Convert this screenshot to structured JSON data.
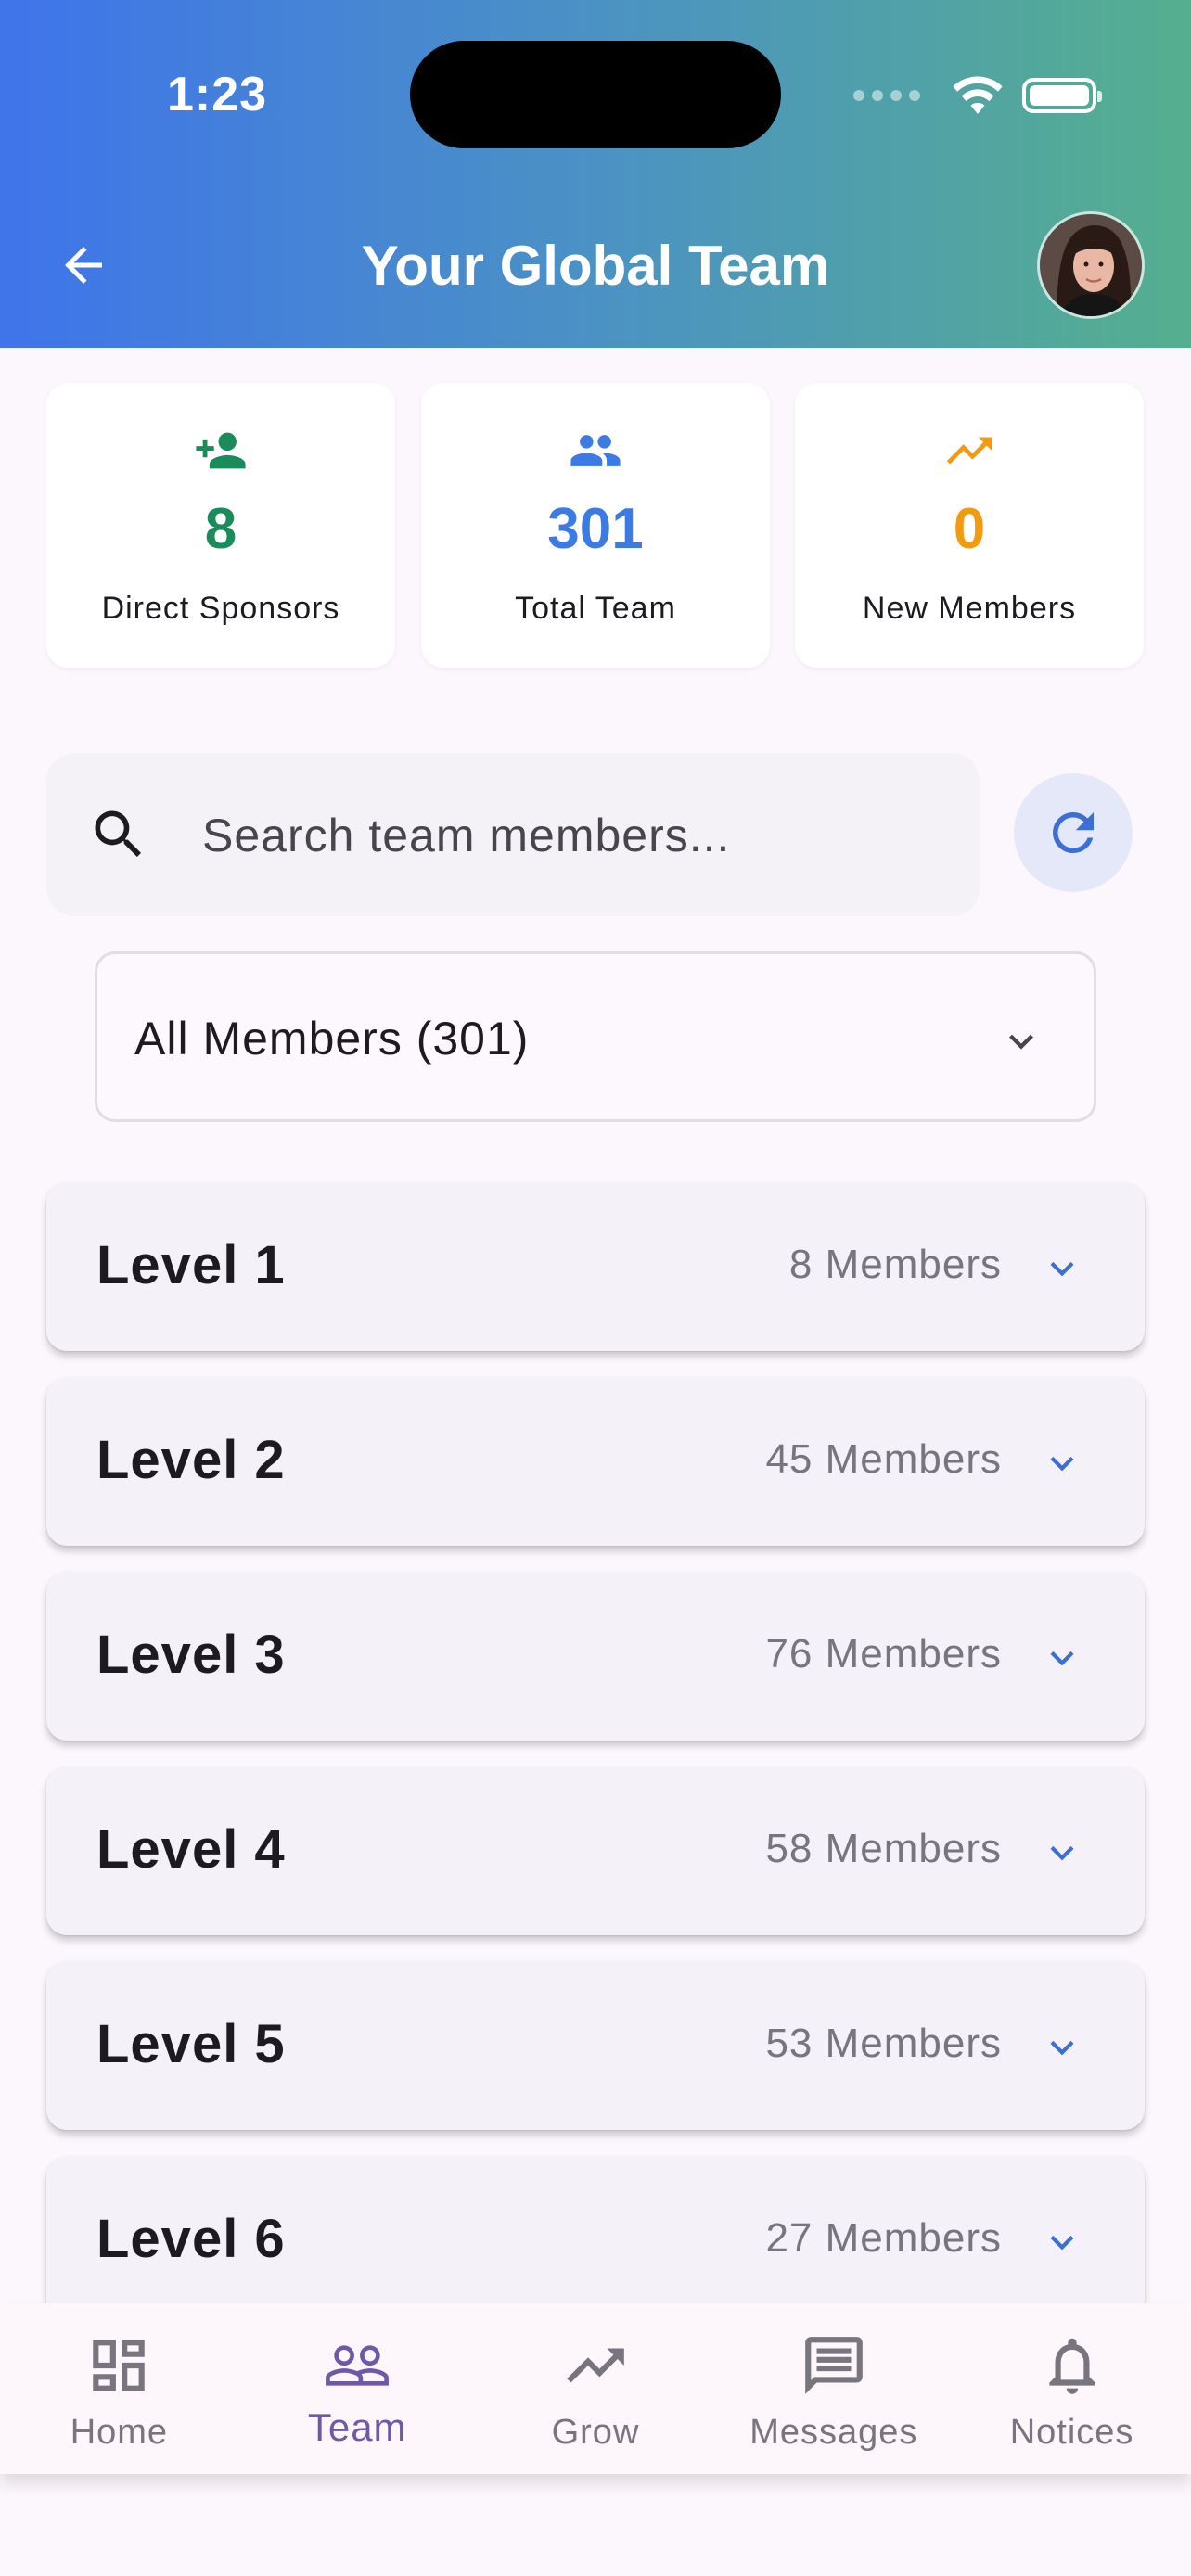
{
  "status_bar": {
    "time": "1:23"
  },
  "header": {
    "title": "Your Global Team"
  },
  "stats": [
    {
      "value": "8",
      "label": "Direct Sponsors",
      "icon": "person-add-icon",
      "color": "#1a8c5b"
    },
    {
      "value": "301",
      "label": "Total Team",
      "icon": "group-icon",
      "color": "#3b7be3"
    },
    {
      "value": "0",
      "label": "New Members",
      "icon": "trending-up-icon",
      "color": "#f29b11"
    }
  ],
  "search": {
    "placeholder": "Search team members..."
  },
  "filter": {
    "selected": "All Members (301)"
  },
  "levels": [
    {
      "name": "Level 1",
      "count": "8 Members"
    },
    {
      "name": "Level 2",
      "count": "45 Members"
    },
    {
      "name": "Level 3",
      "count": "76 Members"
    },
    {
      "name": "Level 4",
      "count": "58 Members"
    },
    {
      "name": "Level 5",
      "count": "53 Members"
    },
    {
      "name": "Level 6",
      "count": "27 Members"
    }
  ],
  "nav": [
    {
      "label": "Home",
      "icon": "dashboard-icon"
    },
    {
      "label": "Team",
      "icon": "people-icon",
      "active": true
    },
    {
      "label": "Grow",
      "icon": "trending-up-icon"
    },
    {
      "label": "Messages",
      "icon": "message-icon"
    },
    {
      "label": "Notices",
      "icon": "bell-icon"
    }
  ],
  "colors": {
    "accent": "#3b6fd6",
    "active_nav": "#6b5aa8",
    "gradient_start": "#3f74ea",
    "gradient_end": "#55af8e"
  }
}
